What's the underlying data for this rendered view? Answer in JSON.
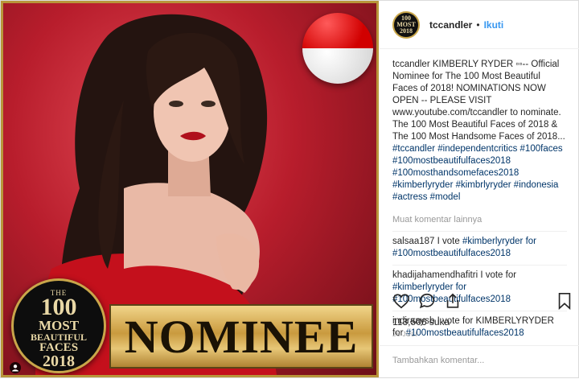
{
  "header": {
    "avatar_text": "100 MOST 2018",
    "username": "tccandler",
    "separator": "•",
    "follow_label": "Ikuti"
  },
  "caption": {
    "username": "tccandler",
    "text_before": " KIMBERLY RYDER ▫▫-- Official Nominee for The 100 Most Beautiful Faces of 2018! NOMINATIONS NOW OPEN -- PLEASE VISIT www.youtube.com/tccandler to nominate. The 100 Most Beautiful Faces of 2018 & The 100 Most Handsome Faces of 2018... ",
    "hashtags": "#tccandler #independentcritics #100faces #100mostbeautifulfaces2018 #100mosthandsomefaces2018 #kimberlyryder #kimbrlyryder #indonesia #actress #model"
  },
  "more_comments_label": "Muat komentar lainnya",
  "comments": [
    {
      "username": "salsaa187",
      "text": " I vote ",
      "tags": "#kimberlyryder for #100mostbeautifulfaces2018"
    },
    {
      "username": "khadijahamendhafitri",
      "text": " I vote for ",
      "tags": "#kimberlyryder for #100mostbeautifulfaces2018"
    },
    {
      "username": "indiraaysb",
      "text": " I vote for KIMBERLYRYDER for ",
      "tags": "#100mostbeautifulfaces2018"
    }
  ],
  "likes": "113,506 suka",
  "date": "26 JULI",
  "add_comment_placeholder": "Tambahkan komentar...",
  "image": {
    "badge": {
      "l1": "THE",
      "l2": "100",
      "l3": "MOST",
      "l4": "BEAUTIFUL",
      "l5": "FACES",
      "l6": "2018"
    },
    "banner_text": "NOMINEE"
  },
  "icons": [
    "heart-icon",
    "comment-icon",
    "share-icon",
    "bookmark-icon",
    "user-tag-icon"
  ],
  "colors": {
    "accent_blue": "#3897f0",
    "gold": "#c9a64a",
    "flag_red": "#d10000"
  }
}
